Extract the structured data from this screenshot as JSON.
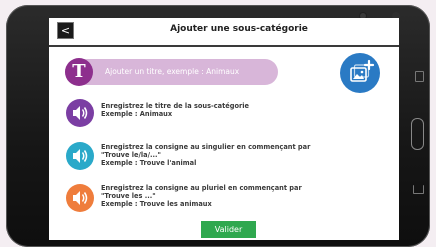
{
  "header": {
    "back_glyph": "<",
    "title": "Ajouter une sous-catégorie"
  },
  "title_input": {
    "badge_letter": "T",
    "placeholder": "Ajouter un titre, exemple : Animaux"
  },
  "add_photo": {
    "icon": "add-photo-icon"
  },
  "record_rows": [
    {
      "color": "#7b3ea3",
      "lines": [
        "Enregistrez le titre de la sous-catégorie",
        "Exemple : Animaux"
      ]
    },
    {
      "color": "#2aa9c9",
      "lines": [
        "Enregistrez la consigne au singulier en commençant par",
        "\"Trouve le/la/...\"",
        "Exemple : Trouve l'animal"
      ]
    },
    {
      "color": "#ef7d3c",
      "lines": [
        "Enregistrez la consigne au pluriel en commençant par",
        "\"Trouve les ...\"",
        "Exemple : Trouve les animaux"
      ]
    }
  ],
  "validate_label": "Valider",
  "colors": {
    "accent_purple": "#8d2f8d",
    "input_bg": "#d8b6d9",
    "photo_blue": "#2a7ac4",
    "validate_green": "#2fa84f"
  }
}
